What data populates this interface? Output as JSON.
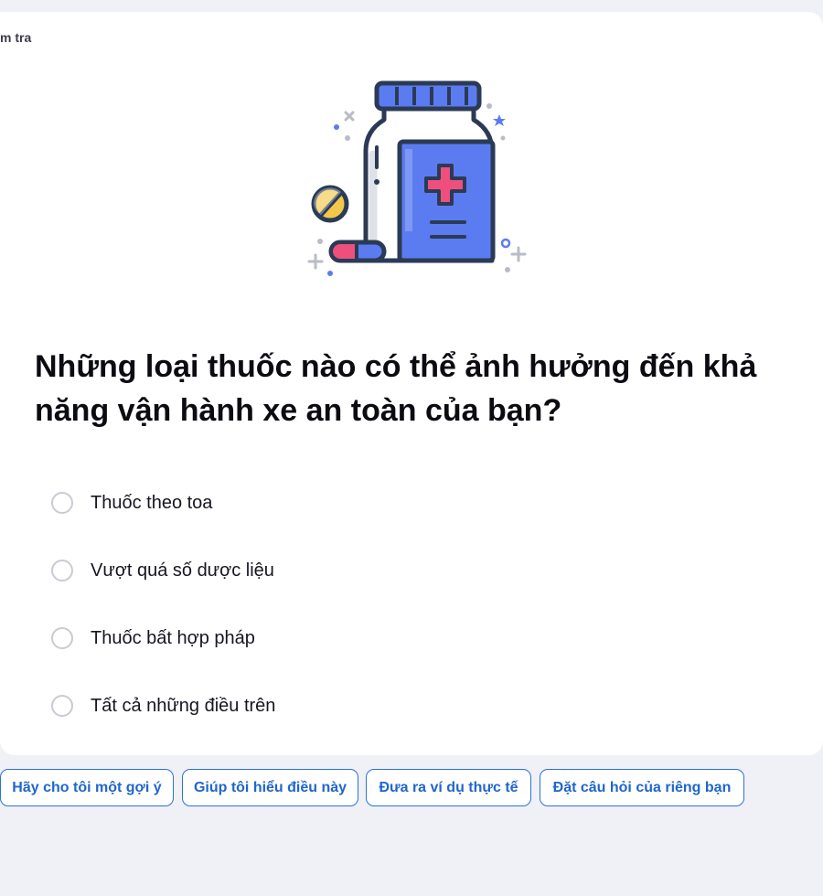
{
  "card": {
    "label": "m tra"
  },
  "illustration": {
    "icon": "medicine-bottle-icon",
    "colors": {
      "outline": "#2b3a55",
      "blue": "#5b7cf0",
      "cross": "#ef4f7c",
      "pill": "#f2c84b",
      "grey": "#b9bcc6"
    }
  },
  "question": {
    "text": "Những loại thuốc nào có thể ảnh hưởng đến khả năng vận hành xe an toàn của bạn?"
  },
  "options": [
    {
      "label": "Thuốc theo toa"
    },
    {
      "label": "Vượt quá số dược liệu"
    },
    {
      "label": "Thuốc bất hợp pháp"
    },
    {
      "label": "Tất cả những điều trên"
    }
  ],
  "chips": [
    {
      "label": "Hãy cho tôi một gợi ý"
    },
    {
      "label": "Giúp tôi hiểu điều này"
    },
    {
      "label": "Đưa ra ví dụ thực tế"
    },
    {
      "label": "Đặt câu hỏi của riêng bạn"
    }
  ],
  "colors": {
    "page_bg": "#f0f1f6",
    "card_bg": "#ffffff",
    "accent": "#2066cc",
    "radio_border": "#c9cbd4"
  }
}
